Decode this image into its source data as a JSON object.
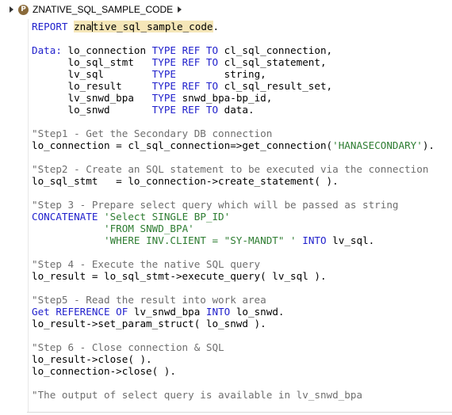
{
  "breadcrumb": {
    "program_icon": "abap-program-icon",
    "program_icon_letter": "P",
    "title": "ZNATIVE_SQL_SAMPLE_CODE"
  },
  "code": {
    "report_kw": "REPORT",
    "report_name_a": "zna",
    "report_name_b": "tive_sql_sample_code",
    "report_end": ".",
    "data_kw": "Data:",
    "decl": [
      {
        "name": " lo_connection ",
        "type_kw": "TYPE REF TO",
        "type": " cl_sql_connection,"
      },
      {
        "name": "      lo_sql_stmt   ",
        "type_kw": "TYPE REF TO",
        "type": " cl_sql_statement,"
      },
      {
        "name": "      lv_sql        ",
        "type_kw": "TYPE",
        "type": "        string,"
      },
      {
        "name": "      lo_result     ",
        "type_kw": "TYPE REF TO",
        "type": " cl_sql_result_set,"
      },
      {
        "name": "      lv_snwd_bpa   ",
        "type_kw": "TYPE",
        "type": " snwd_bpa-bp_id,"
      },
      {
        "name": "      lo_snwd       ",
        "type_kw": "TYPE REF TO",
        "type": " data."
      }
    ],
    "step1_comment": "\"Step1 - Get the Secondary DB connection",
    "step1_a": "lo_connection = cl_sql_connection=>get_connection(",
    "step1_str": "'HANASECONDARY'",
    "step1_b": ").",
    "step2_comment": "\"Step2 - Create an SQL statement to be executed via the connection",
    "step2_code": "lo_sql_stmt   = lo_connection->create_statement( ).",
    "step3_comment": "\"Step 3 - Prepare select query which will be passed as string",
    "step3_kw": "CONCATENATE",
    "step3_str1": "'Select SINGLE BP_ID'",
    "step3_indent": "            ",
    "step3_str2": "'FROM SNWD_BPA'",
    "step3_str3": "'WHERE INV.CLIENT = \"SY-MANDT\" '",
    "step3_into_kw": "INTO",
    "step3_end": " lv_sql.",
    "step4_comment": "\"Step 4 - Execute the native SQL query",
    "step4_code": "lo_result = lo_sql_stmt->execute_query( lv_sql ).",
    "step5_comment": "\"Step5 - Read the result into work area",
    "step5_kw1": "Get REFERENCE OF",
    "step5_mid": " lv_snwd_bpa ",
    "step5_kw2": "INTO",
    "step5_end": " lo_snwd.",
    "step5_code2": "lo_result->set_param_struct( lo_snwd ).",
    "step6_comment": "\"Step 6 - Close connection & SQL",
    "step6_code1": "lo_result->close( ).",
    "step6_code2": "lo_connection->close( ).",
    "final_comment": "\"The output of select query is available in lv_snwd_bpa"
  },
  "colors": {
    "keyword": "#1f1fcc",
    "comment": "#6e6e6e",
    "string": "#2e7d32",
    "highlight": "#f5e6b8"
  }
}
